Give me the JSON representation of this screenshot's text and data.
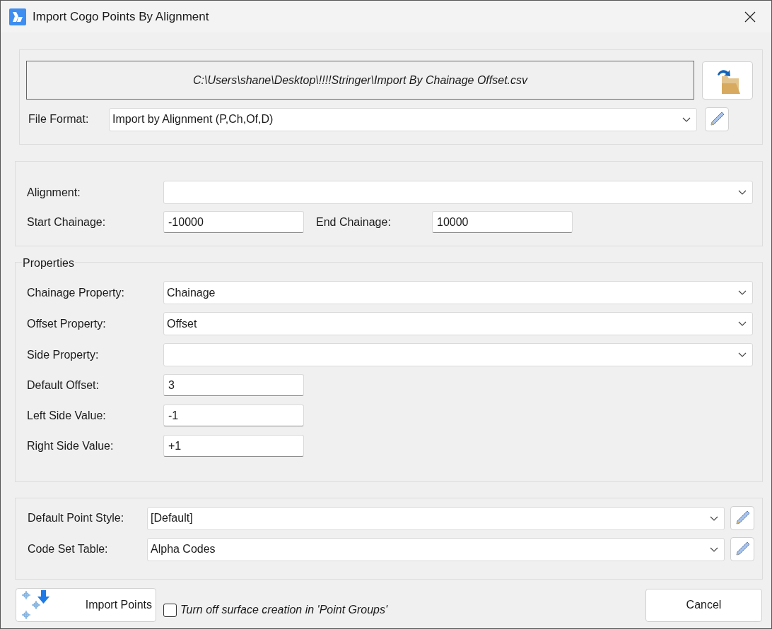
{
  "window": {
    "title": "Import Cogo Points By Alignment"
  },
  "file": {
    "path": "C:\\Users\\shane\\Desktop\\!!!!Stringer\\Import By Chainage Offset.csv",
    "format_label": "File Format:",
    "format_value": "Import by Alignment (P,Ch,Of,D)"
  },
  "alignment": {
    "label": "Alignment:"
  },
  "chainage": {
    "start_label": "Start Chainage:",
    "start_value": "-10000",
    "end_label": "End Chainage:",
    "end_value": "10000"
  },
  "properties": {
    "title": "Properties",
    "rows": [
      {
        "kind": "dropdown",
        "label": "Chainage Property:",
        "value": "Chainage"
      },
      {
        "kind": "dropdown",
        "label": "Offset Property:",
        "value": "Offset"
      },
      {
        "kind": "dropdown",
        "label": "Side Property:"
      },
      {
        "kind": "text",
        "label": "Default Offset:",
        "value": "3"
      },
      {
        "kind": "text",
        "label": "Left Side Value:",
        "value": "-1"
      },
      {
        "kind": "text",
        "label": "Right Side Value:",
        "value": "+1"
      }
    ]
  },
  "styles": {
    "rows": [
      {
        "label": "Default Point Style:",
        "value": "[Default]"
      },
      {
        "label": "Code Set Table:",
        "value": "Alpha Codes"
      }
    ]
  },
  "footer": {
    "import_button": "Import Points",
    "checkbox": {
      "label": "Turn off surface creation in 'Point Groups'",
      "checked": false
    },
    "cancel_button": "Cancel"
  }
}
